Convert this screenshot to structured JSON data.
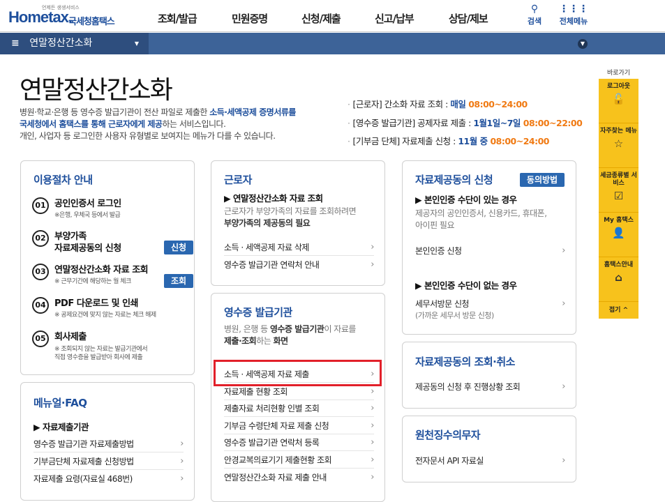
{
  "header": {
    "logo_small": "언제든 생생서비스",
    "logo_text": "Hometax.",
    "logo_kr": "국세청홈택스",
    "nav": [
      "조회/발급",
      "민원증명",
      "신청/제출",
      "신고/납부",
      "상담/제보"
    ],
    "search_label": "검색",
    "allmenu_label": "전체메뉴"
  },
  "subbar": {
    "title": "연말정산간소화"
  },
  "page": {
    "title": "연말정산간소화",
    "desc_1": "병원·학교·은행 등 영수증 발급기관이 전산 파일로 제출한 ",
    "desc_1b": "소득·세액공제 증명서류를",
    "desc_2b": "국세청에서 홈택스를 통해 근로자에게 제공",
    "desc_2": "하는 서비스입니다.",
    "desc_3": "개인, 사업자 등 로그인한 사용자 유형별로 보여지는 메뉴가 다를 수 있습니다.",
    "schedule": [
      {
        "label": "[근로자] 간소화 자료 조회 : ",
        "em": "매일 ",
        "or": "08:00~24:00"
      },
      {
        "label": "[영수증 발급기관] 공제자료 제출 : ",
        "em": "1월1일~7일 ",
        "or": "08:00~22:00"
      },
      {
        "label": "[기부금 단체] 자료제출 신청 : ",
        "em": "11월 중 ",
        "or": "08:00~24:00"
      }
    ]
  },
  "procedure": {
    "title": "이용절차 안내",
    "steps": [
      {
        "num": "01",
        "title": "공인인증서 로그인",
        "sub": "※은행, 우체국 등에서 발급"
      },
      {
        "num": "02",
        "title": "부양가족",
        "title2": "자료제공동의 신청",
        "badge": "신청"
      },
      {
        "num": "03",
        "title": "연말정산간소화 자료 조회",
        "sub": "※ 근무기간에 해당하는 월 체크",
        "badge": "조회"
      },
      {
        "num": "04",
        "title": "PDF 다운로드 및 인쇄",
        "sub": "※ 공제요건에 맞지 않는 자료는 체크 해제"
      },
      {
        "num": "05",
        "title": "회사제출",
        "sub": "※ 조회되지 않는 자료는 발급기관에서",
        "sub2": "직접 영수증을 발급받아 회사에 제출"
      }
    ]
  },
  "manual": {
    "title": "메뉴얼·FAQ",
    "section": "▶ 자료제출기관",
    "items": [
      "영수증 발급기관 자료제출방법",
      "기부금단체 자료제출 신청방법",
      "자료제출 요령(자료실 468번)"
    ]
  },
  "worker": {
    "title": "근로자",
    "section": "▶ 연말정산간소화 자료 조회",
    "gray1": "근로자가 부양가족의 자료를 조회하려면",
    "gray2b": "부양가족의 제공동의 필요",
    "items": [
      "소득 · 세액공제 자료 삭제",
      "영수증 발급기관 연락처 안내"
    ]
  },
  "issuer": {
    "title": "영수증 발급기관",
    "gray1a": "병원, 은행 등 ",
    "gray1b": "영수증 발급기관",
    "gray1c": "이 자료를",
    "gray2b": "제출·조회",
    "gray2c": "하는 ",
    "gray2d": "화면",
    "items": [
      "소득 · 세액공제 자료 제출",
      "자료제출 현황 조회",
      "제출자료 처리현황 인별 조회",
      "기부금 수령단체 자료 제출 신청",
      "영수증 발급기관 연락처 등록",
      "안경교복의료기기 제출현황 조회",
      "연말정산간소화 자료 제출 안내"
    ]
  },
  "consent": {
    "title": "자료제공동의 신청",
    "button": "동의방법",
    "section1": "▶ 본인인증 수단이 있는 경우",
    "gray1": "제공자의 공인인증서, 신용카드, 휴대폰,",
    "gray2": "아이핀 필요",
    "item1": "본인인증 신청",
    "section2": "▶ 본인인증 수단이 없는 경우",
    "item2": "세무서방문 신청",
    "item2_sub": "(가까운 세무서 방문 신청)"
  },
  "consent_cancel": {
    "title": "자료제공동의 조회·취소",
    "item": "제공동의 신청 후 진행상황 조회"
  },
  "withholding": {
    "title": "원천징수의무자",
    "item": "전자문서 API 자료실"
  },
  "quick": {
    "label": "바로가기",
    "items": [
      {
        "title": "로그아웃",
        "icon": "lock-icon",
        "glyph": "🔓"
      },
      {
        "title": "자주찾는 메뉴",
        "icon": "star-icon",
        "glyph": "☆"
      },
      {
        "title": "세금종류별 서비스",
        "icon": "checkbox-icon",
        "glyph": "☑"
      },
      {
        "title": "My 홈택스",
        "icon": "person-icon",
        "glyph": "👤"
      },
      {
        "title": "홈택스안내",
        "icon": "home-icon",
        "glyph": "⌂"
      }
    ],
    "fold": "접기 ^"
  }
}
